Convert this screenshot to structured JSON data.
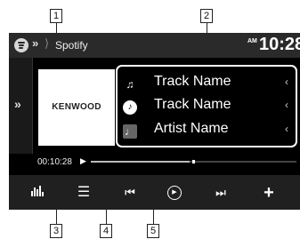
{
  "callouts": [
    "1",
    "2",
    "3",
    "4",
    "5"
  ],
  "header": {
    "source_name": "Spotify",
    "clock_ampm": "AM",
    "clock_time": "10:28"
  },
  "album_art": {
    "brand_text": "KENWOOD"
  },
  "track_info": [
    {
      "icon": "music-note-icon",
      "text": "Track Name"
    },
    {
      "icon": "album-icon",
      "text": "Track Name"
    },
    {
      "icon": "artist-icon",
      "text": "Artist Name"
    }
  ],
  "playback": {
    "elapsed_time": "00:10:28",
    "progress_fraction": 0.48
  },
  "controls": [
    "equalizer-icon",
    "list-icon",
    "previous-icon",
    "play-icon",
    "next-icon",
    "add-icon"
  ],
  "colors": {
    "screen_bg": "#000000",
    "text": "#ffffff",
    "bar_bg": "#202020"
  }
}
